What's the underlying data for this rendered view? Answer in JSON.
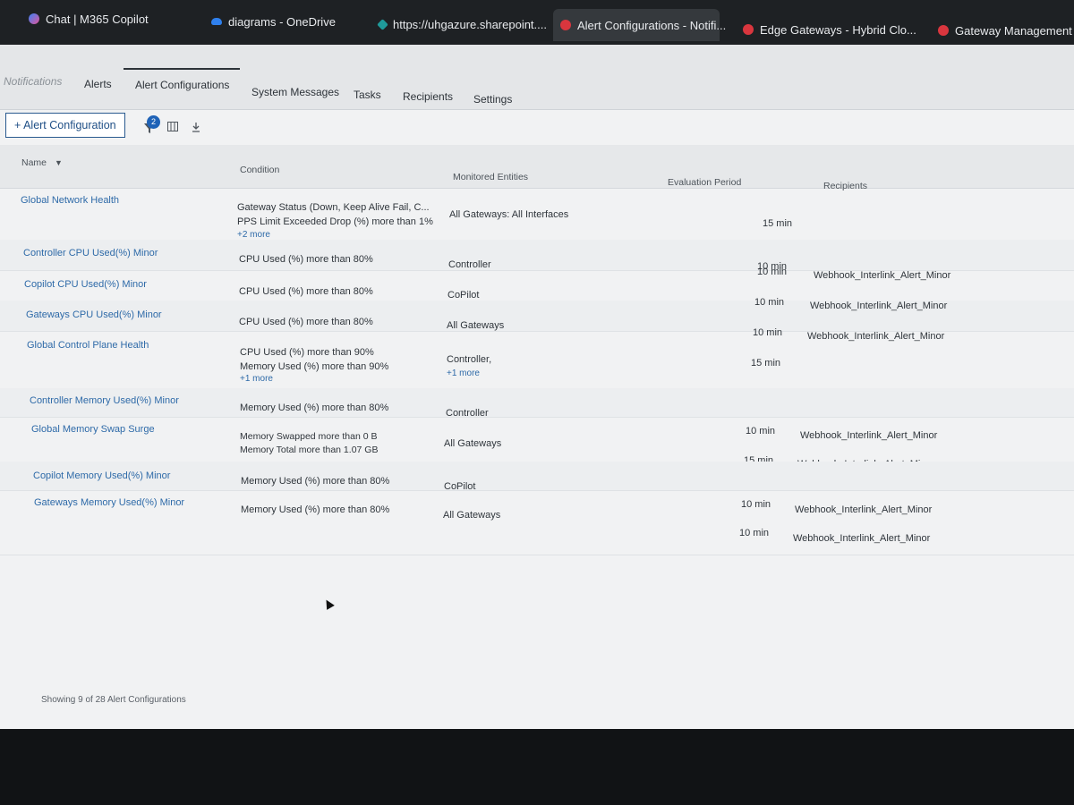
{
  "browser": {
    "tabs": [
      {
        "title": "Chat | M365 Copilot",
        "icon": "copilot-icon"
      },
      {
        "title": "diagrams - OneDrive",
        "icon": "onedrive-icon"
      },
      {
        "title": "https://uhgazure.sharepoint....",
        "icon": "sharepoint-icon"
      },
      {
        "title": "Alert Configurations - Notifi...",
        "icon": "red-app-icon",
        "active": true
      },
      {
        "title": "Edge Gateways - Hybrid Clo...",
        "icon": "red-app-icon"
      },
      {
        "title": "Gateway Management",
        "icon": "red-app-icon"
      }
    ]
  },
  "nav": {
    "tabs": [
      "Notifications",
      "Alerts",
      "Alert Configurations",
      "System Messages",
      "Tasks",
      "Recipients",
      "Settings"
    ],
    "active": "Alert Configurations"
  },
  "toolbar": {
    "add_label": "+ Alert Configuration",
    "filter_count": "2",
    "icons": [
      "filter-icon",
      "columns-icon",
      "download-icon"
    ]
  },
  "table": {
    "columns": [
      "Name",
      "Condition",
      "Monitored Entities",
      "Evaluation Period",
      "Recipients"
    ],
    "rows": [
      {
        "name": "Global Network Health",
        "cond": [
          "Gateway Status (Down, Keep Alive Fail, C...",
          "PPS Limit Exceeded Drop (%) more than 1%"
        ],
        "cond_more": "+2 more",
        "entities": "All Gateways: All Interfaces",
        "entities_more": "",
        "period": "15 min",
        "recipients": ""
      },
      {
        "name": "Controller CPU Used(%) Minor",
        "cond": [
          "CPU Used (%) more than 80%"
        ],
        "cond_more": "",
        "entities": "Controller",
        "entities_more": "",
        "period": "10 min",
        "recipients": "Webhook_Interlink_Alert_Minor"
      },
      {
        "name": "Copilot CPU Used(%) Minor",
        "cond": [
          "CPU Used (%) more than 80%"
        ],
        "cond_more": "",
        "entities": "CoPilot",
        "entities_more": "",
        "period": "10 min",
        "recipients": "Webhook_Interlink_Alert_Minor"
      },
      {
        "name": "Gateways CPU Used(%) Minor",
        "cond": [
          "CPU Used (%) more than 80%"
        ],
        "cond_more": "",
        "entities": "All Gateways",
        "entities_more": "",
        "period": "10 min",
        "recipients": "Webhook_Interlink_Alert_Minor"
      },
      {
        "name": "Global Control Plane Health",
        "cond": [
          "CPU Used (%) more than 90%",
          "Memory Used (%) more than 90%"
        ],
        "cond_more": "+1 more",
        "entities": "Controller,",
        "entities_more": "+1 more",
        "period": "15 min",
        "recipients": ""
      },
      {
        "name": "Controller Memory Used(%) Minor",
        "cond": [
          "Memory Used (%) more than 80%"
        ],
        "cond_more": "",
        "entities": "Controller",
        "entities_more": "",
        "period": "10 min",
        "recipients": "Webhook_Interlink_Alert_Minor"
      },
      {
        "name": "Global Memory Swap Surge",
        "cond": [
          "Memory Swapped more than 0 B",
          "Memory Total more than 1.07 GB"
        ],
        "cond_more": "",
        "entities": "All Gateways",
        "entities_more": "",
        "period": "15 min",
        "recipients": "Webhook_Interlink_Alert_Minor"
      },
      {
        "name": "Copilot Memory Used(%) Minor",
        "cond": [
          "Memory Used (%) more than 80%"
        ],
        "cond_more": "",
        "entities": "CoPilot",
        "entities_more": "",
        "period": "10 min",
        "recipients": "Webhook_Interlink_Alert_Minor"
      },
      {
        "name": "Gateways Memory Used(%) Minor",
        "cond": [
          "Memory Used (%) more than 80%"
        ],
        "cond_more": "",
        "entities": "All Gateways",
        "entities_more": "",
        "period": "10 min",
        "recipients": "Webhook_Interlink_Alert_Minor"
      }
    ]
  },
  "footer": {
    "text": "Showing 9 of 28 Alert Configurations"
  },
  "colors": {
    "accent": "#1f63b7",
    "link": "#2e6aa8",
    "browser_chrome": "#1e2124"
  }
}
